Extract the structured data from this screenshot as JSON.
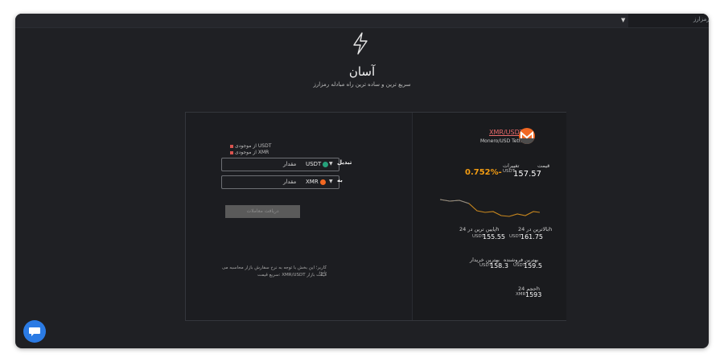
{
  "topbar": {
    "right_text": "رمزارز"
  },
  "hero": {
    "title": "آسان",
    "subtitle": "سریع ترین و ساده ترین راه مبادله رمزارز"
  },
  "converter": {
    "rates": [
      "از موجودی USDT",
      "از موجودی XMR"
    ],
    "from": {
      "label": "تبدیل",
      "coin": "USDT",
      "placeholder": "مقدار"
    },
    "to": {
      "label": "به",
      "coin": "XMR",
      "placeholder": "مقدار"
    },
    "submit_label": "دریافت معاملات",
    "note_line1": "کاربر؛ این بخش با توجه به نرخ سفارش بازار محاسبه می شود",
    "note_line2": "سریع قیمت: XMR/USDT قیمت بازار"
  },
  "market": {
    "pair": "XMR/USDT",
    "pair_name": "Monero/USD Tether",
    "price_label": "قیمت",
    "change_label": "تغییرات",
    "price": "157.57",
    "price_unit": "USDT",
    "change": "0.752%-",
    "high_label": "بالاترین در 24h",
    "low_label": "پایین ترین در 24h",
    "high": "161.75",
    "high_unit": "USDT",
    "low": "155.55",
    "low_unit": "USDT",
    "best_sell_label": "بهترین فروشنده",
    "best_buy_label": "بهترین خریدار",
    "best_sell": "159.5",
    "best_sell_unit": "USDT",
    "best_buy": "158.3",
    "best_buy_unit": "USDT",
    "volume_label": "حجم 24h",
    "volume": "1593",
    "volume_unit": "XMR"
  },
  "colors": {
    "accent": "#f39c12",
    "pair_link": "#e86a6a",
    "chat": "#2b7be4",
    "monero": "#f26822",
    "tether": "#26a17b"
  },
  "icons": {
    "hero": "lightning-icon",
    "chat": "chat-icon",
    "monero": "monero-logo",
    "tether": "tether-logo"
  }
}
